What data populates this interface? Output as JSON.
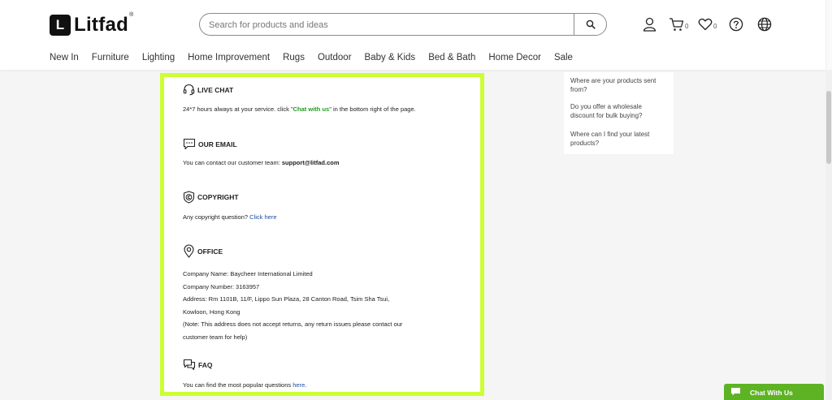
{
  "header": {
    "logo_letter": "L",
    "logo_text": "Litfad",
    "logo_reg": "®",
    "search_placeholder": "Search for products and ideas",
    "cart_count": "0",
    "wishlist_count": "0"
  },
  "nav": {
    "items": [
      "New In",
      "Furniture",
      "Lighting",
      "Home Improvement",
      "Rugs",
      "Outdoor",
      "Baby & Kids",
      "Bed & Bath",
      "Home Decor",
      "Sale"
    ]
  },
  "sections": {
    "live_chat": {
      "title": "LIVE CHAT",
      "text_before": "24*7 hours always at your service. click \"",
      "link": "Chat with us",
      "text_after": "\" in the bottom right of the page."
    },
    "email": {
      "title": "OUR EMAIL",
      "text": "You can contact our customer team: ",
      "address": "support@litfad.com"
    },
    "copyright": {
      "title": "COPYRIGHT",
      "text": "Any copyright question? ",
      "link": "Click here"
    },
    "office": {
      "title": "OFFICE",
      "lines": [
        "Company Name: Baycheer International Limited",
        "Company Number: 3163957",
        "Address: Rm 1101B, 11/F, Lippo Sun Plaza, 28 Canton Road, Tsim Sha Tsui,",
        "Kowloon, Hong Kong",
        "(Note: This address does not accept returns, any return issues please contact our",
        "customer team for help)"
      ]
    },
    "faq": {
      "title": "FAQ",
      "text": "You can find the most popular questions ",
      "link": "here",
      "end": "."
    }
  },
  "sidebar_faq": {
    "items": [
      "Where are your products sent from?",
      "Do you offer a wholesale discount for bulk buying?",
      "Where can I find your latest products?"
    ]
  },
  "chat_button": {
    "label": "Chat With Us"
  },
  "colors": {
    "highlight_border": "#ccff33",
    "chat_green": "#5eb324",
    "link_green": "#239b23",
    "link_blue": "#1a4fa0"
  }
}
